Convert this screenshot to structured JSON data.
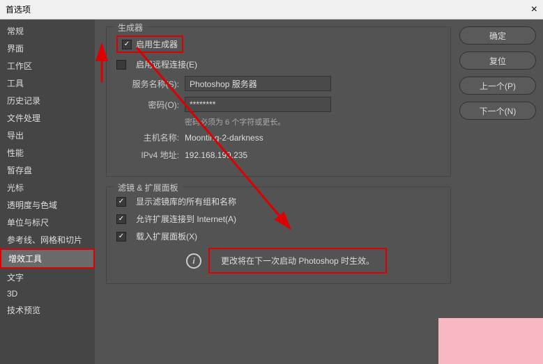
{
  "title": "首选项",
  "sidebar": {
    "items": [
      {
        "label": "常规"
      },
      {
        "label": "界面"
      },
      {
        "label": "工作区"
      },
      {
        "label": "工具"
      },
      {
        "label": "历史记录"
      },
      {
        "label": "文件处理"
      },
      {
        "label": "导出"
      },
      {
        "label": "性能"
      },
      {
        "label": "暂存盘"
      },
      {
        "label": "光标"
      },
      {
        "label": "透明度与色域"
      },
      {
        "label": "单位与标尺"
      },
      {
        "label": "参考线、网格和切片"
      },
      {
        "label": "增效工具"
      },
      {
        "label": "文字"
      },
      {
        "label": "3D"
      },
      {
        "label": "技术预览"
      }
    ]
  },
  "buttons": {
    "ok": "确定",
    "reset": "复位",
    "prev": "上一个(P)",
    "next": "下一个(N)"
  },
  "generator": {
    "legend": "生成器",
    "enable": "启用生成器",
    "remote": "启用远程连接(E)",
    "service_label": "服务名称(S):",
    "service_value": "Photoshop 服务器",
    "password_label": "密码(O):",
    "password_value": "********",
    "password_hint": "密码必须为 6 个字符或更长。",
    "host_label": "主机名称:",
    "host_value": "Moonting-2-darkness",
    "ip_label": "IPv4 地址:",
    "ip_value": "192.168.199.235"
  },
  "plugins": {
    "legend": "滤镜 & 扩展面板",
    "show_all": "显示滤镜库的所有组和名称",
    "allow_internet": "允许扩展连接到 Internet(A)",
    "load_panels": "载入扩展面板(X)",
    "info_text": "更改将在下一次启动 Photoshop 时生效。"
  }
}
